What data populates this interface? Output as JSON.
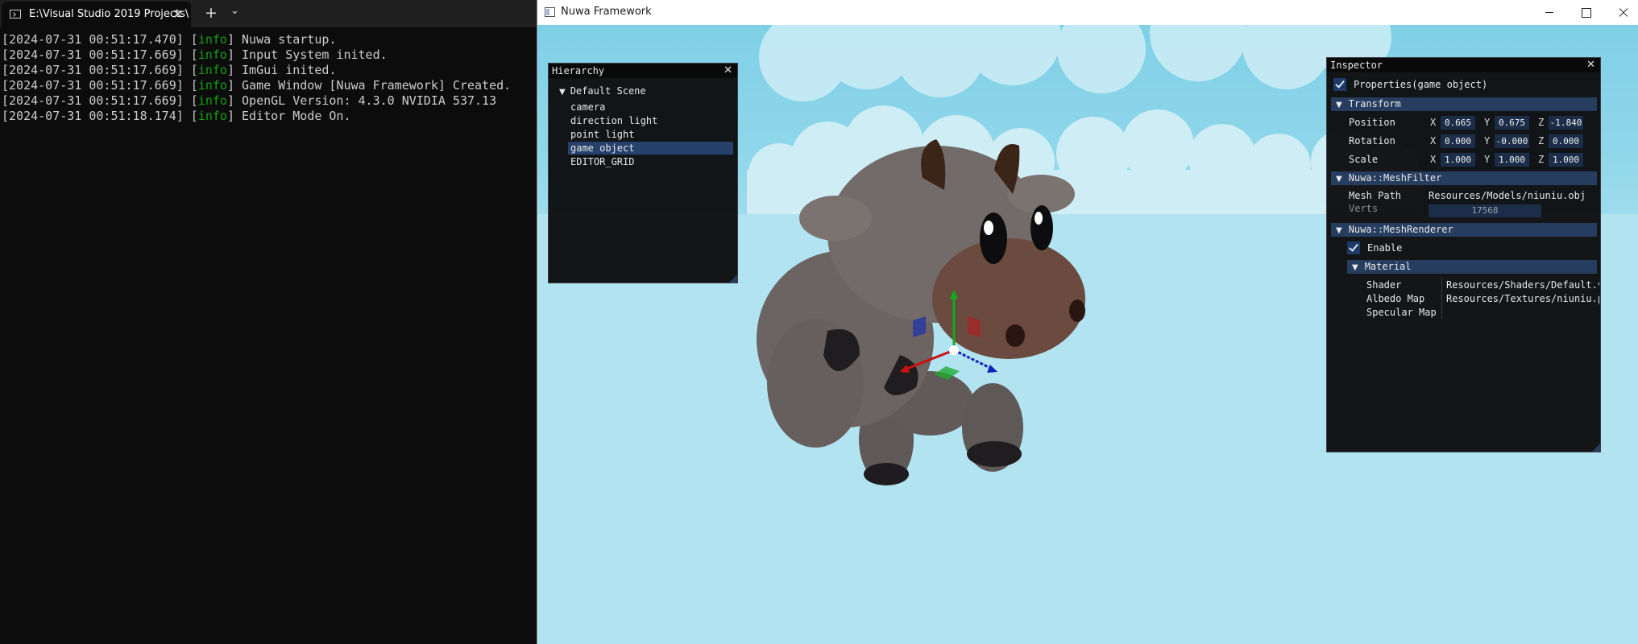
{
  "terminal": {
    "tab_title": "E:\\Visual Studio 2019 Projects\\",
    "close_glyph": "✕",
    "newtab_glyph": "+",
    "dropdown_glyph": "⌄",
    "logs": [
      {
        "ts": "[2024-07-31 00:51:17.470]",
        "level": "info",
        "msg": "Nuwa startup."
      },
      {
        "ts": "[2024-07-31 00:51:17.669]",
        "level": "info",
        "msg": "Input System inited."
      },
      {
        "ts": "[2024-07-31 00:51:17.669]",
        "level": "info",
        "msg": "ImGui inited."
      },
      {
        "ts": "[2024-07-31 00:51:17.669]",
        "level": "info",
        "msg": "Game Window [Nuwa Framework] Created."
      },
      {
        "ts": "[2024-07-31 00:51:17.669]",
        "level": "info",
        "msg": "OpenGL Version: 4.3.0 NVIDIA 537.13"
      },
      {
        "ts": "[2024-07-31 00:51:18.174]",
        "level": "info",
        "msg": "Editor Mode On."
      }
    ],
    "colors": {
      "background": "#0c0c0c",
      "text": "#cccccc",
      "info": "#13a10e"
    }
  },
  "game_window": {
    "title": "Nuwa Framework",
    "icons": {
      "minimize": "minimize-icon",
      "maximize": "maximize-icon",
      "close": "close-icon"
    }
  },
  "hierarchy": {
    "title": "Hierarchy",
    "close_glyph": "✕",
    "root": "Default Scene",
    "arrow": "▼",
    "items": [
      "camera",
      "direction light",
      "point light",
      "game object",
      "EDITOR_GRID"
    ],
    "selected_index": 3
  },
  "inspector": {
    "title": "Inspector",
    "close_glyph": "✕",
    "properties_label": "Properties(game object)",
    "properties_checked": true,
    "transform": {
      "header": "Transform",
      "axes": [
        "X",
        "Y",
        "Z"
      ],
      "rows": [
        {
          "label": "Position",
          "values": [
            "0.665",
            "0.675",
            "-1.840"
          ]
        },
        {
          "label": "Rotation",
          "values": [
            "0.000",
            "-0.000",
            "0.000"
          ]
        },
        {
          "label": "Scale",
          "values": [
            "1.000",
            "1.000",
            "1.000"
          ]
        }
      ]
    },
    "mesh_filter": {
      "header": "Nuwa::MeshFilter",
      "mesh_path_label": "Mesh Path",
      "mesh_path_value": "Resources/Models/niuniu.obj",
      "verts_label": "Verts",
      "verts_value": "17568"
    },
    "mesh_renderer": {
      "header": "Nuwa::MeshRenderer",
      "enable_label": "Enable",
      "enable_checked": true,
      "material": {
        "header": "Material",
        "rows": [
          {
            "label": "Shader",
            "value": "Resources/Shaders/Default.v"
          },
          {
            "label": "Albedo Map",
            "value": "Resources/Textures/niuniu.p"
          },
          {
            "label": "Specular Map",
            "value": ""
          }
        ]
      }
    },
    "arrow": "▼"
  },
  "scene": {
    "colors": {
      "sky_top": "#7fd0e6",
      "sky_bottom": "#b1e3f0",
      "cloud": "#d9f1f8",
      "cow_body": "#6f6866",
      "cow_spot": "#1f1d1f",
      "gizmo_x": "#cc1111",
      "gizmo_y": "#11aa22",
      "gizmo_z": "#1122bb"
    }
  }
}
